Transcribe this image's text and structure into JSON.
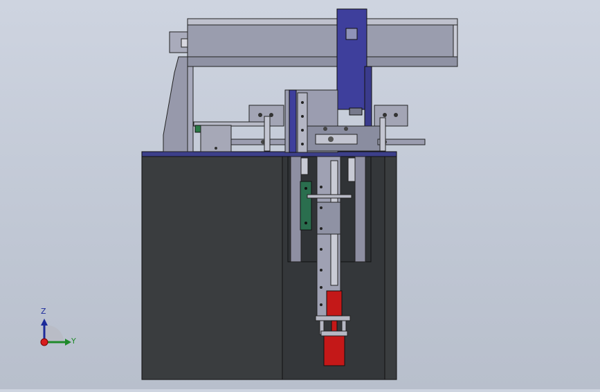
{
  "viewport": {
    "background_top": "#ced4e0",
    "background_bottom": "#b8bfcc"
  },
  "model": {
    "colors": {
      "base_cabinet": "#3a3d3f",
      "table_top": "#3c3f8a",
      "gantry_beam": "#9a9dae",
      "z_axis_carriage": "#3e3f9c",
      "metal_plate": "#8e8fa2",
      "green_sensor": "#2a6e4e",
      "red_cylinder": "#c41818"
    }
  },
  "triad": {
    "z_label": "Z",
    "y_label": "Y",
    "z_color": "#1b2a9a",
    "y_color": "#1f8a2a",
    "origin_color": "#d81e1e"
  }
}
